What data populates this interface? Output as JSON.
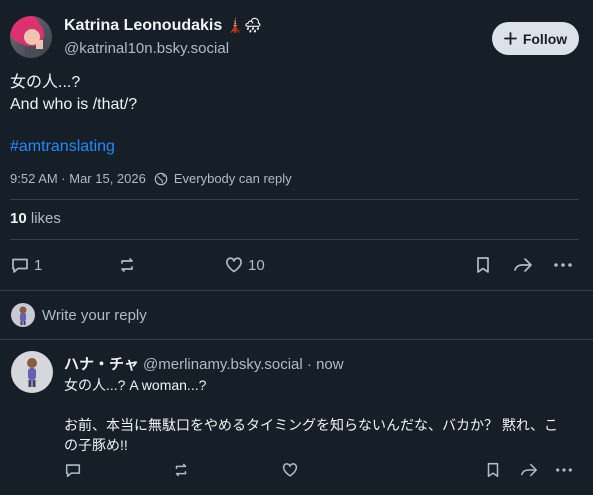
{
  "post": {
    "display_name": "Katrina Leonoudakis",
    "name_emojis": "🗼🌧",
    "handle": "@katrinal10n.bsky.social",
    "follow_label": "Follow",
    "line1": "女の人...?",
    "line2": "And who is /that/?",
    "hashtag": "#amtranslating",
    "timestamp": "9:52 AM · Mar 15, 2026",
    "reply_setting": "Everybody can reply",
    "likes_count": "10",
    "likes_label": "likes",
    "reply_count": "1",
    "like_count_action": "10"
  },
  "reply_box": {
    "placeholder": "Write your reply"
  },
  "comment": {
    "display_name": "ハナ・チャ",
    "handle": "@merlinamy.bsky.social",
    "time": "· now",
    "text": "女の人...? A woman...?\n\nお前、本当に無駄口をやめるタイミングを知らないんだな、バカか？ 黙れ、この子豚め!!"
  },
  "colors": {
    "background": "#161e27",
    "accent_link": "#208bfe",
    "muted_text": "#aebbc9",
    "border": "#2e4052"
  }
}
